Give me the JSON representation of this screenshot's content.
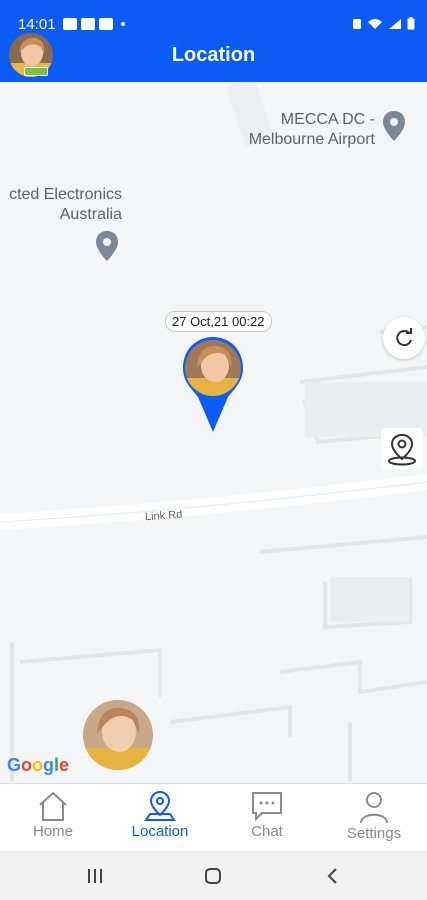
{
  "status_bar": {
    "time": "14:01"
  },
  "header": {
    "title": "Location"
  },
  "map": {
    "pois": [
      {
        "name": "MECCA DC -\nMelbourne Airport"
      },
      {
        "name": "cted Electronics\nAustralia"
      }
    ],
    "road_label": "Link Rd",
    "marker_timestamp": "27 Oct,21 00:22",
    "attribution": "Google"
  },
  "tabs": [
    {
      "label": "Home",
      "active": false
    },
    {
      "label": "Location",
      "active": true
    },
    {
      "label": "Chat",
      "active": false
    },
    {
      "label": "Settings",
      "active": false
    }
  ],
  "colors": {
    "accent": "#0a5cf5",
    "map_bg": "#f4f5f7",
    "battery": "#7cc242"
  }
}
